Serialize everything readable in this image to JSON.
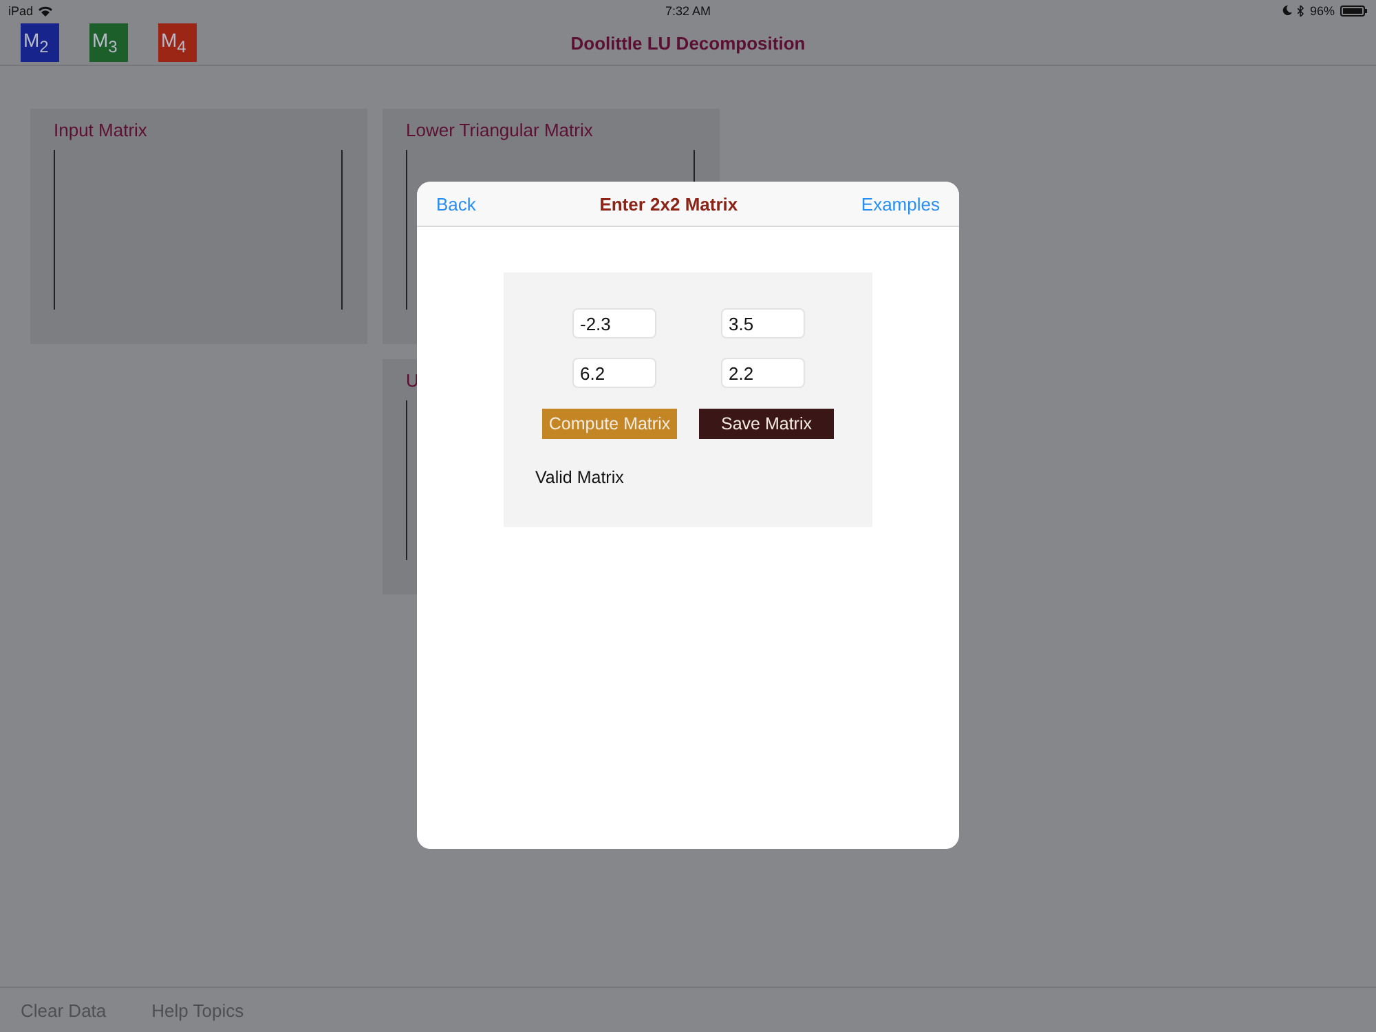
{
  "status_bar": {
    "device": "iPad",
    "time": "7:32 AM",
    "battery": "96%"
  },
  "toolbar": {
    "title": "Doolittle LU Decomposition",
    "matrix_buttons": [
      {
        "label": "M$_{2}$",
        "color": "#17248c"
      },
      {
        "label": "M$_{3}$",
        "color": "#1d5f2a"
      },
      {
        "label": "M$_{4}$",
        "color": "#9c2616"
      }
    ]
  },
  "panels": [
    {
      "title": "Input Matrix"
    },
    {
      "title": "Lower Triangular Matrix"
    },
    {
      "title": "U"
    }
  ],
  "dialog": {
    "back": "Back",
    "title": "Enter 2x2 Matrix",
    "examples": "Examples",
    "cells": [
      [
        "-2.3",
        "3.5"
      ],
      [
        "6.2",
        "2.2"
      ]
    ],
    "compute": "Compute Matrix",
    "save": "Save Matrix",
    "message": "Valid Matrix"
  },
  "bottom_bar": [
    "Clear Data",
    "Help Topics"
  ]
}
